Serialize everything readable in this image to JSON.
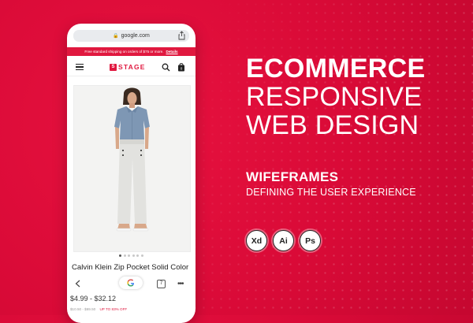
{
  "browser": {
    "url": "google.com"
  },
  "store": {
    "promo_text": "Free standard shipping on orders of $75 or more.",
    "promo_link": "Details",
    "brand_name": "STAGE",
    "brand_mark": "S",
    "brand_color": "#e0183f"
  },
  "product": {
    "name": "Calvin Klein Zip Pocket Solid Color",
    "price": "$4.99 - $32.12",
    "original_price": "$10.50 - $69.50",
    "discount": "UP TO 83% OFF",
    "image_count": 6,
    "active_image": 1
  },
  "browser_toolbar": {
    "tab_count": "7",
    "more": "•••"
  },
  "hero": {
    "line1": "ECOMMERCE",
    "line2": "RESPONSIVE",
    "line3": "WEB DESIGN",
    "subtitle": "WIFEFRAMES",
    "tagline": "DEFINING THE USER EXPERIENCE"
  },
  "tools": [
    {
      "label": "Xd",
      "icon": "adobe-xd-icon"
    },
    {
      "label": "Ai",
      "icon": "adobe-illustrator-icon"
    },
    {
      "label": "Ps",
      "icon": "adobe-photoshop-icon"
    }
  ],
  "colors": {
    "background": "#d90a37",
    "accent": "#e0183f",
    "text": "#ffffff"
  }
}
